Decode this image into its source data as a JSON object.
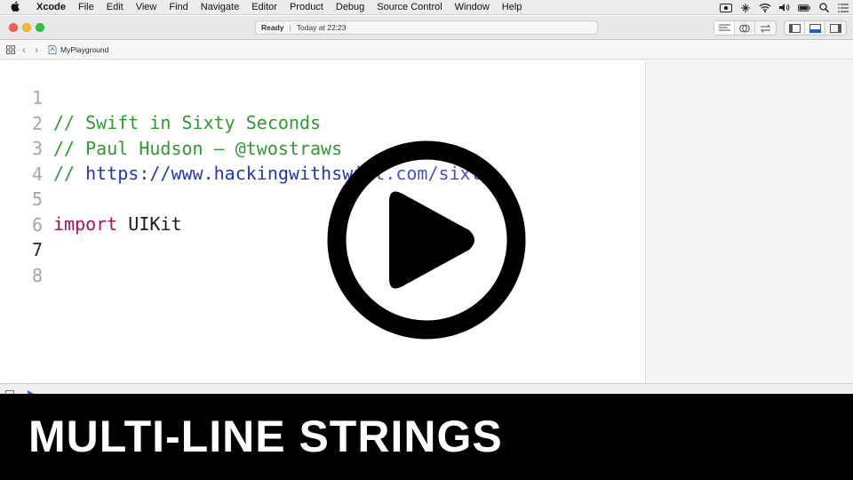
{
  "menubar": {
    "app_name": "Xcode",
    "items": [
      "File",
      "Edit",
      "View",
      "Find",
      "Navigate",
      "Editor",
      "Product",
      "Debug",
      "Source Control",
      "Window",
      "Help"
    ]
  },
  "toolbar": {
    "activity_status": "Ready",
    "activity_time": "Today at 22:23"
  },
  "jumpbar": {
    "file_name": "MyPlayground"
  },
  "editor": {
    "lines": [
      {
        "number": "1",
        "text": "// Swift in Sixty Seconds"
      },
      {
        "number": "2",
        "text": "// Paul Hudson — @twostraws"
      },
      {
        "number": "3",
        "comment_prefix": "// ",
        "url": "https://www.hackingwithswift.com/sixty"
      },
      {
        "number": "4",
        "text": ""
      },
      {
        "number": "5",
        "keyword": "import",
        "text": " UIKit"
      },
      {
        "number": "6",
        "text": ""
      },
      {
        "number": "7",
        "text": ""
      },
      {
        "number": "8",
        "text": ""
      }
    ],
    "current_line": "7"
  },
  "banner": {
    "title": "MULTI-LINE STRINGS"
  },
  "colors": {
    "comment": "#2d9b2d",
    "url": "#1f36c9",
    "keyword": "#a8135a",
    "banner_bg": "#000000"
  },
  "icons": {
    "play_overlay": "play-button-icon"
  }
}
